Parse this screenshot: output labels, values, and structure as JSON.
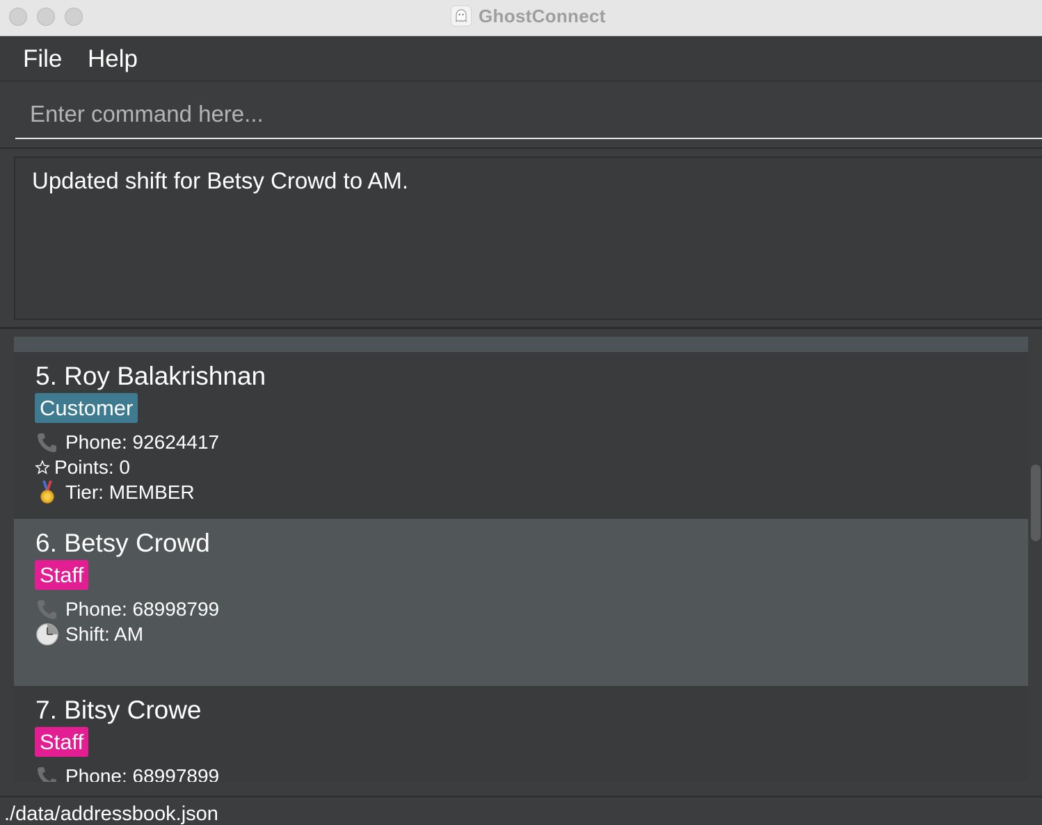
{
  "window": {
    "title": "GhostConnect",
    "app_icon": "ghost-icon"
  },
  "menu": {
    "file_label": "File",
    "help_label": "Help"
  },
  "command": {
    "placeholder": "Enter command here...",
    "value": ""
  },
  "result": {
    "message": "Updated shift for Betsy Crowd to AM."
  },
  "contacts": [
    {
      "index_name": "5. Roy Balakrishnan",
      "tag": "Customer",
      "phone": "Phone: 92624417",
      "points": "Points: 0",
      "tier": "Tier: MEMBER"
    },
    {
      "index_name": "6. Betsy Crowd",
      "tag": "Staff",
      "phone": "Phone: 68998799",
      "shift": "Shift: AM"
    },
    {
      "index_name": "7. Bitsy Crowe",
      "tag": "Staff",
      "phone": "Phone: 68997899"
    }
  ],
  "status": {
    "file_path": "./data/addressbook.json"
  },
  "colors": {
    "customer_tag": "#3e7b91",
    "staff_tag": "#e31d92",
    "selected_card": "#515659"
  }
}
